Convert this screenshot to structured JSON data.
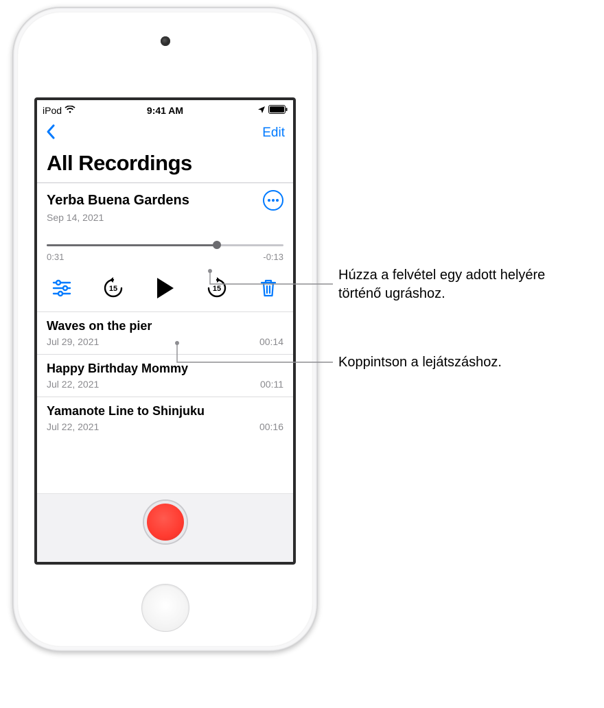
{
  "statusbar": {
    "carrier": "iPod",
    "time": "9:41 AM"
  },
  "nav": {
    "edit_label": "Edit"
  },
  "page_title": "All Recordings",
  "selected": {
    "title": "Yerba Buena Gardens",
    "date": "Sep 14, 2021",
    "elapsed": "0:31",
    "remaining": "-0:13",
    "skip_seconds": "15"
  },
  "items": [
    {
      "title": "Waves on the pier",
      "date": "Jul 29, 2021",
      "duration": "00:14"
    },
    {
      "title": "Happy Birthday Mommy",
      "date": "Jul 22, 2021",
      "duration": "00:11"
    },
    {
      "title": "Yamanote Line to Shinjuku",
      "date": "Jul 22, 2021",
      "duration": "00:16"
    }
  ],
  "callouts": {
    "scrub": "Húzza a felvétel egy adott helyére történő ugráshoz.",
    "play": "Koppintson a lejátszáshoz."
  }
}
